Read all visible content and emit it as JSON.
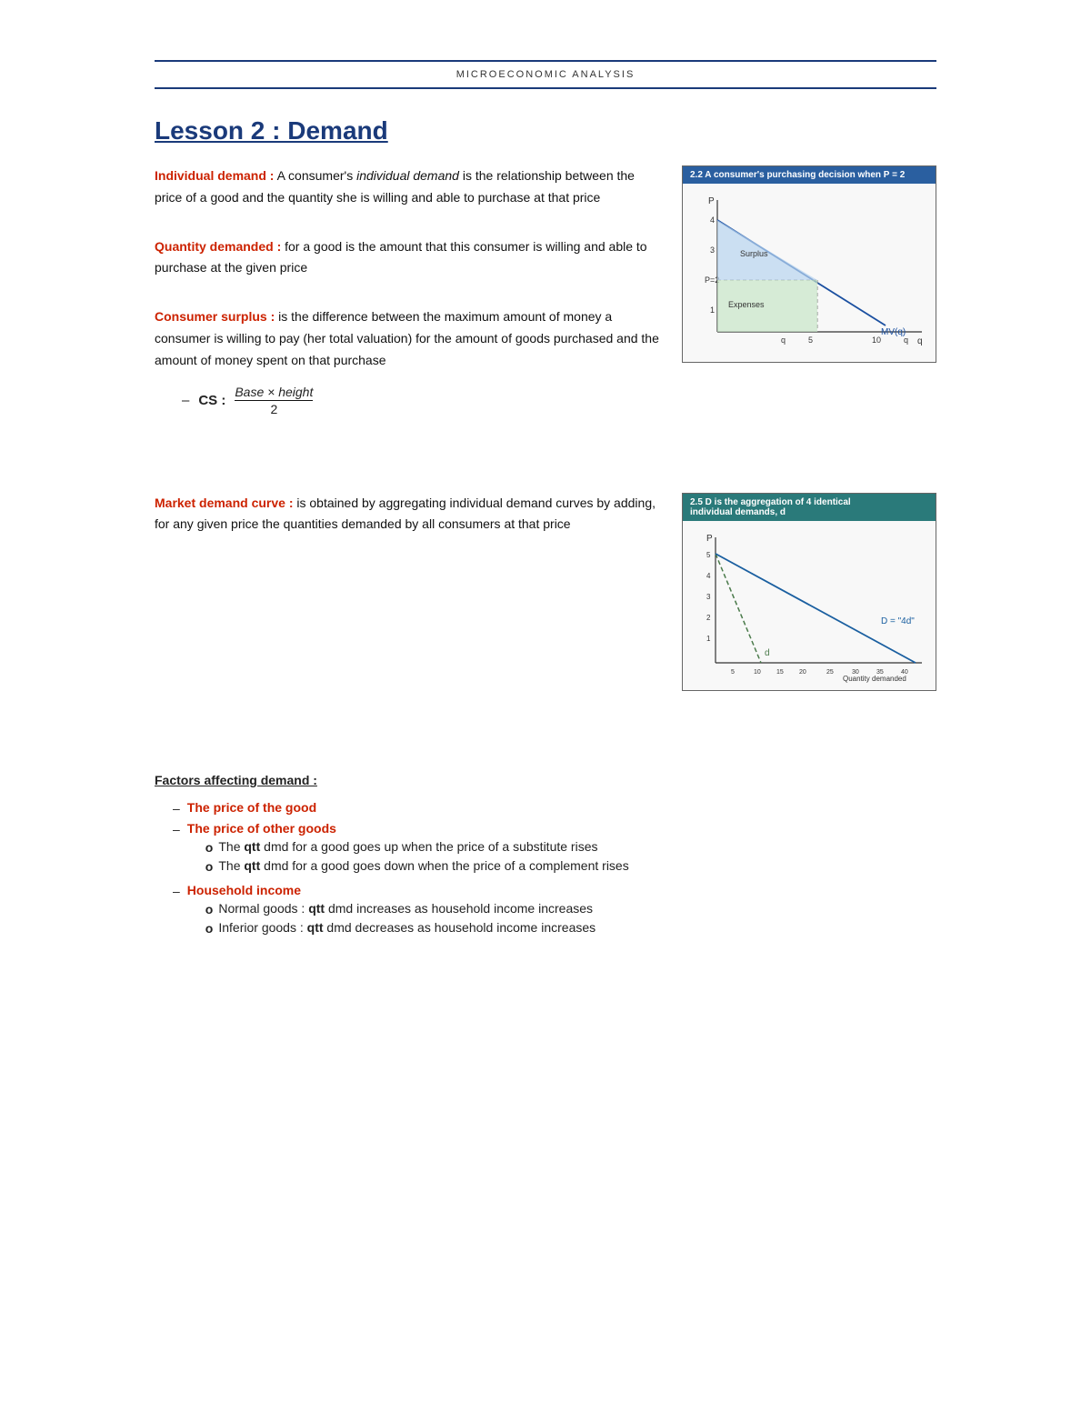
{
  "header": {
    "title": "Microeconomic Analysis",
    "line1": "",
    "line2": ""
  },
  "lesson": {
    "title": "Lesson 2 : Demand"
  },
  "definitions": [
    {
      "term": "Individual demand :",
      "text": " A consumer's ",
      "italic": "individual demand",
      "text2": " is the relationship between the price of a good and the quantity she is willing and able to purchase at that price"
    },
    {
      "term": "Quantity demanded :",
      "text": " for a good is the amount that this consumer is willing and able to purchase at the given price"
    },
    {
      "term": "Consumer surplus :",
      "text": " is the difference between the maximum amount of money a consumer is willing to pay (her total valuation) for the amount of goods purchased and the amount of money spent on that purchase"
    }
  ],
  "cs_formula": {
    "label": "CS :",
    "numerator": "Base × height",
    "denominator": "2"
  },
  "graph1": {
    "header": "2.2  A consumer's purchasing decision when P = 2",
    "surplus_label": "Surplus",
    "expenses_label": "Expenses",
    "mv_label": "MV(q)",
    "p_label": "P",
    "q_label": "q",
    "price_level": "P = 2"
  },
  "market_demand": {
    "term": "Market demand curve :",
    "text": " is obtained by aggregating individual demand curves by adding, for any given price the quantities demanded by all consumers at that price"
  },
  "graph2": {
    "header1": "2.5  D is the aggregation of 4 identical",
    "header2": "individual demands, d",
    "d_label": "d",
    "D_label": "D = \"4d\"",
    "y_label": "P",
    "x_label": "Quantity demanded"
  },
  "factors": {
    "heading": "Factors affecting demand :",
    "items": [
      {
        "bullet": "–",
        "text": "The price of the good",
        "color": "red",
        "sub": []
      },
      {
        "bullet": "–",
        "text": "The price of other goods",
        "color": "red",
        "sub": [
          "The qtt dmd for a good goes up when the price of a substitute rises",
          "The qtt dmd for a good goes down when the price of a complement rises"
        ]
      },
      {
        "bullet": "–",
        "text": "Household income",
        "color": "red",
        "sub": [
          "Normal goods : qtt dmd increases as household income increases",
          "Inferior goods : qtt dmd decreases as household income increases"
        ]
      }
    ]
  }
}
